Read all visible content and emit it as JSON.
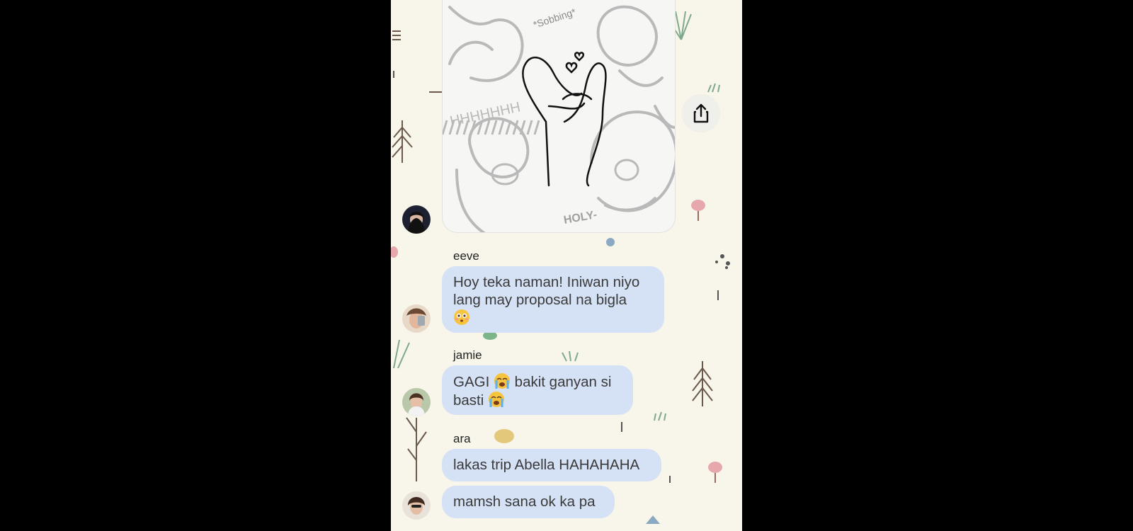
{
  "colors": {
    "background": "#f8f6ea",
    "bubble": "#d5e1f5",
    "text": "#3a3a3a"
  },
  "image_message": {
    "doodle_text": [
      "*Sobbing*",
      "HHHHHHH",
      "HOLY-"
    ],
    "share_icon": "share-icon"
  },
  "messages": [
    {
      "sender": "eeve",
      "bubbles": [
        {
          "text_a": "Hoy teka naman! Iniwan niyo",
          "text_b": "lang may proposal na bigla",
          "emoji": "flushed-face-emoji"
        }
      ]
    },
    {
      "sender": "jamie",
      "bubbles": [
        {
          "text_a": "GAGI",
          "text_b": "bakit ganyan si",
          "text_c": "basti",
          "emoji": "loudly-crying-face-emoji"
        }
      ]
    },
    {
      "sender": "ara",
      "bubbles": [
        {
          "text": "lakas trip Abella HAHAHAHA"
        },
        {
          "text": "mamsh sana ok ka pa"
        }
      ]
    }
  ]
}
